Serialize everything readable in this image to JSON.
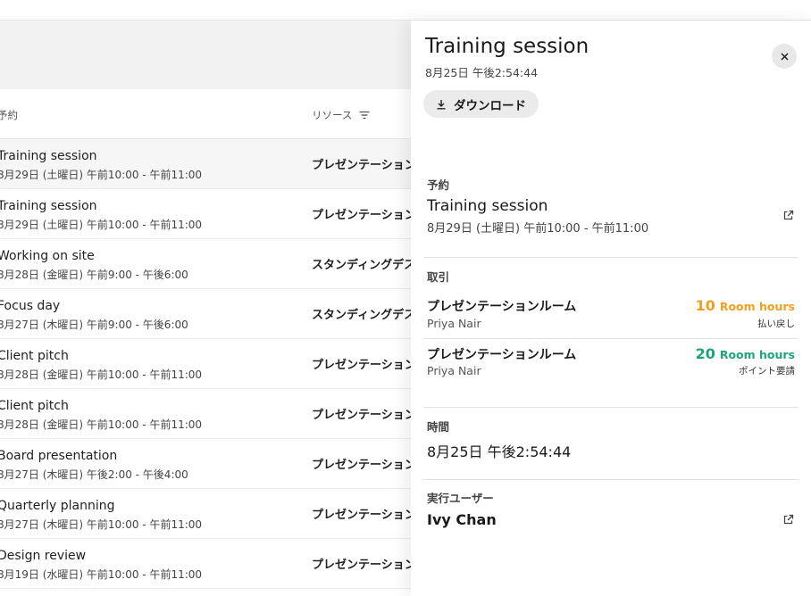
{
  "table": {
    "headers": {
      "booking": "予約",
      "resource": "リソース"
    },
    "rows": [
      {
        "title": "Training session",
        "sub": "8月29日 (土曜日) 午前10:00 - 午前11:00",
        "resource": "プレゼンテーションルーム"
      },
      {
        "title": "Training session",
        "sub": "8月29日 (土曜日) 午前10:00 - 午前11:00",
        "resource": "プレゼンテーションルーム"
      },
      {
        "title": "Working on site",
        "sub": "8月28日 (金曜日) 午前9:00 - 午後6:00",
        "resource": "スタンディングデスク"
      },
      {
        "title": "Focus day",
        "sub": "8月27日 (木曜日) 午前9:00 - 午後6:00",
        "resource": "スタンディングデスク"
      },
      {
        "title": "Client pitch",
        "sub": "8月28日 (金曜日) 午前10:00 - 午前11:00",
        "resource": "プレゼンテーションルーム"
      },
      {
        "title": "Client pitch",
        "sub": "8月28日 (金曜日) 午前10:00 - 午前11:00",
        "resource": "プレゼンテーションルーム"
      },
      {
        "title": "Board presentation",
        "sub": "8月27日 (木曜日) 午後2:00 - 午後4:00",
        "resource": "プレゼンテーションルーム"
      },
      {
        "title": "Quarterly planning",
        "sub": "8月27日 (木曜日) 午前10:00 - 午前11:00",
        "resource": "プレゼンテーションルーム"
      },
      {
        "title": "Design review",
        "sub": "8月19日 (水曜日) 午前10:00 - 午前11:00",
        "resource": "プレゼンテーションルーム"
      }
    ]
  },
  "panel": {
    "title": "Training session",
    "timestamp": "8月25日 午後2:54:44",
    "download_label": "ダウンロード",
    "booking_label": "予約",
    "booking_title": "Training session",
    "booking_sub": "8月29日 (土曜日) 午前10:00 - 午前11:00",
    "transactions_label": "取引",
    "transactions": [
      {
        "resource": "プレゼンテーションルーム",
        "user": "Priya Nair",
        "amount": "10",
        "unit": "Room hours",
        "note": "払い戻し",
        "color": "#f0a020"
      },
      {
        "resource": "プレゼンテーションルーム",
        "user": "Priya Nair",
        "amount": "20",
        "unit": "Room hours",
        "note": "ポイント要請",
        "color": "#1fa37a"
      }
    ],
    "time_label": "時間",
    "time_value": "8月25日 午後2:54:44",
    "executor_label": "実行ユーザー",
    "executor_value": "Ivy Chan"
  },
  "icons": {
    "close": "close-icon",
    "download": "download-icon",
    "external": "external-link-icon",
    "filter": "filter-icon"
  }
}
